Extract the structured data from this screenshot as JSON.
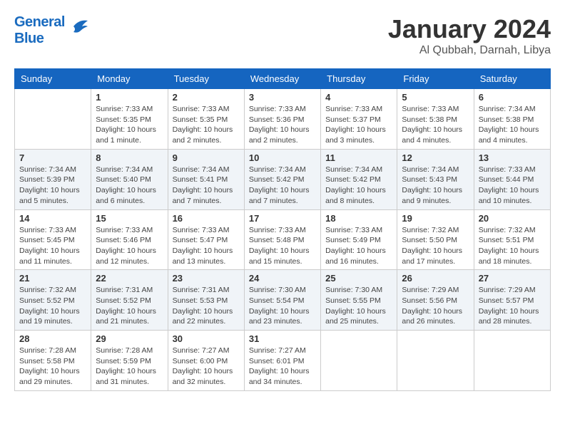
{
  "header": {
    "logo_top": "General",
    "logo_bottom": "Blue",
    "month": "January 2024",
    "location": "Al Qubbah, Darnah, Libya"
  },
  "days_of_week": [
    "Sunday",
    "Monday",
    "Tuesday",
    "Wednesday",
    "Thursday",
    "Friday",
    "Saturday"
  ],
  "weeks": [
    [
      {
        "day": "",
        "info": ""
      },
      {
        "day": "1",
        "info": "Sunrise: 7:33 AM\nSunset: 5:35 PM\nDaylight: 10 hours\nand 1 minute."
      },
      {
        "day": "2",
        "info": "Sunrise: 7:33 AM\nSunset: 5:35 PM\nDaylight: 10 hours\nand 2 minutes."
      },
      {
        "day": "3",
        "info": "Sunrise: 7:33 AM\nSunset: 5:36 PM\nDaylight: 10 hours\nand 2 minutes."
      },
      {
        "day": "4",
        "info": "Sunrise: 7:33 AM\nSunset: 5:37 PM\nDaylight: 10 hours\nand 3 minutes."
      },
      {
        "day": "5",
        "info": "Sunrise: 7:33 AM\nSunset: 5:38 PM\nDaylight: 10 hours\nand 4 minutes."
      },
      {
        "day": "6",
        "info": "Sunrise: 7:34 AM\nSunset: 5:38 PM\nDaylight: 10 hours\nand 4 minutes."
      }
    ],
    [
      {
        "day": "7",
        "info": "Sunrise: 7:34 AM\nSunset: 5:39 PM\nDaylight: 10 hours\nand 5 minutes."
      },
      {
        "day": "8",
        "info": "Sunrise: 7:34 AM\nSunset: 5:40 PM\nDaylight: 10 hours\nand 6 minutes."
      },
      {
        "day": "9",
        "info": "Sunrise: 7:34 AM\nSunset: 5:41 PM\nDaylight: 10 hours\nand 7 minutes."
      },
      {
        "day": "10",
        "info": "Sunrise: 7:34 AM\nSunset: 5:42 PM\nDaylight: 10 hours\nand 7 minutes."
      },
      {
        "day": "11",
        "info": "Sunrise: 7:34 AM\nSunset: 5:42 PM\nDaylight: 10 hours\nand 8 minutes."
      },
      {
        "day": "12",
        "info": "Sunrise: 7:34 AM\nSunset: 5:43 PM\nDaylight: 10 hours\nand 9 minutes."
      },
      {
        "day": "13",
        "info": "Sunrise: 7:33 AM\nSunset: 5:44 PM\nDaylight: 10 hours\nand 10 minutes."
      }
    ],
    [
      {
        "day": "14",
        "info": "Sunrise: 7:33 AM\nSunset: 5:45 PM\nDaylight: 10 hours\nand 11 minutes."
      },
      {
        "day": "15",
        "info": "Sunrise: 7:33 AM\nSunset: 5:46 PM\nDaylight: 10 hours\nand 12 minutes."
      },
      {
        "day": "16",
        "info": "Sunrise: 7:33 AM\nSunset: 5:47 PM\nDaylight: 10 hours\nand 13 minutes."
      },
      {
        "day": "17",
        "info": "Sunrise: 7:33 AM\nSunset: 5:48 PM\nDaylight: 10 hours\nand 15 minutes."
      },
      {
        "day": "18",
        "info": "Sunrise: 7:33 AM\nSunset: 5:49 PM\nDaylight: 10 hours\nand 16 minutes."
      },
      {
        "day": "19",
        "info": "Sunrise: 7:32 AM\nSunset: 5:50 PM\nDaylight: 10 hours\nand 17 minutes."
      },
      {
        "day": "20",
        "info": "Sunrise: 7:32 AM\nSunset: 5:51 PM\nDaylight: 10 hours\nand 18 minutes."
      }
    ],
    [
      {
        "day": "21",
        "info": "Sunrise: 7:32 AM\nSunset: 5:52 PM\nDaylight: 10 hours\nand 19 minutes."
      },
      {
        "day": "22",
        "info": "Sunrise: 7:31 AM\nSunset: 5:52 PM\nDaylight: 10 hours\nand 21 minutes."
      },
      {
        "day": "23",
        "info": "Sunrise: 7:31 AM\nSunset: 5:53 PM\nDaylight: 10 hours\nand 22 minutes."
      },
      {
        "day": "24",
        "info": "Sunrise: 7:30 AM\nSunset: 5:54 PM\nDaylight: 10 hours\nand 23 minutes."
      },
      {
        "day": "25",
        "info": "Sunrise: 7:30 AM\nSunset: 5:55 PM\nDaylight: 10 hours\nand 25 minutes."
      },
      {
        "day": "26",
        "info": "Sunrise: 7:29 AM\nSunset: 5:56 PM\nDaylight: 10 hours\nand 26 minutes."
      },
      {
        "day": "27",
        "info": "Sunrise: 7:29 AM\nSunset: 5:57 PM\nDaylight: 10 hours\nand 28 minutes."
      }
    ],
    [
      {
        "day": "28",
        "info": "Sunrise: 7:28 AM\nSunset: 5:58 PM\nDaylight: 10 hours\nand 29 minutes."
      },
      {
        "day": "29",
        "info": "Sunrise: 7:28 AM\nSunset: 5:59 PM\nDaylight: 10 hours\nand 31 minutes."
      },
      {
        "day": "30",
        "info": "Sunrise: 7:27 AM\nSunset: 6:00 PM\nDaylight: 10 hours\nand 32 minutes."
      },
      {
        "day": "31",
        "info": "Sunrise: 7:27 AM\nSunset: 6:01 PM\nDaylight: 10 hours\nand 34 minutes."
      },
      {
        "day": "",
        "info": ""
      },
      {
        "day": "",
        "info": ""
      },
      {
        "day": "",
        "info": ""
      }
    ]
  ]
}
